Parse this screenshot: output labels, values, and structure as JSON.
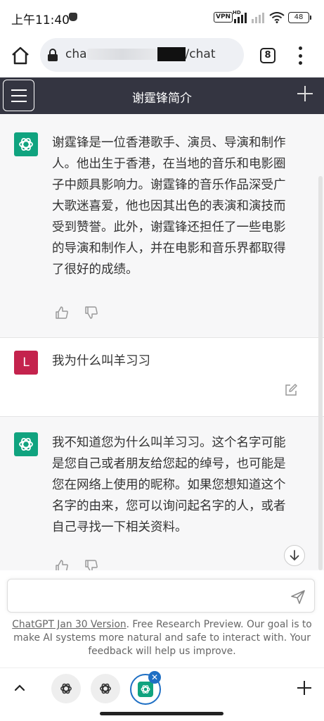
{
  "status_bar": {
    "time": "上午11:40",
    "vpn_label": "VPN",
    "network_label": "HD",
    "battery": "48"
  },
  "browser": {
    "url_prefix": "cha",
    "url_suffix": "/chat",
    "tab_count": "8"
  },
  "chat_header": {
    "title": "谢霆锋简介"
  },
  "messages": [
    {
      "role": "assistant",
      "text": "谢霆锋是一位香港歌手、演员、导演和制作人。他出生于香港，在当地的音乐和电影圈子中颇具影响力。谢霆锋的音乐作品深受广大歌迷喜爱，他也因其出色的表演和演技而受到赞誉。此外，谢霆锋还担任了一些电影的导演和制作人，并在电影和音乐界都取得了很好的成绩。"
    },
    {
      "role": "user",
      "avatar_letter": "L",
      "text": "我为什么叫羊习习"
    },
    {
      "role": "assistant",
      "text": "我不知道您为什么叫羊习习。这个名字可能是您自己或者朋友给您起的绰号，也可能是您在网络上使用的昵称。如果您想知道这个名字的由来，您可以询问起名字的人，或者自己寻找一下相关资料。"
    }
  ],
  "composer": {
    "placeholder": ""
  },
  "footer": {
    "version_link": "ChatGPT Jan 30 Version",
    "note": ". Free Research Preview. Our goal is to make AI systems more natural and safe to interact with. Your feedback will help us improve."
  },
  "colors": {
    "header_bg": "#343541",
    "assistant_avatar": "#10a37f",
    "user_avatar": "#c4234d",
    "active_tab_ring": "#1e6fc4"
  }
}
